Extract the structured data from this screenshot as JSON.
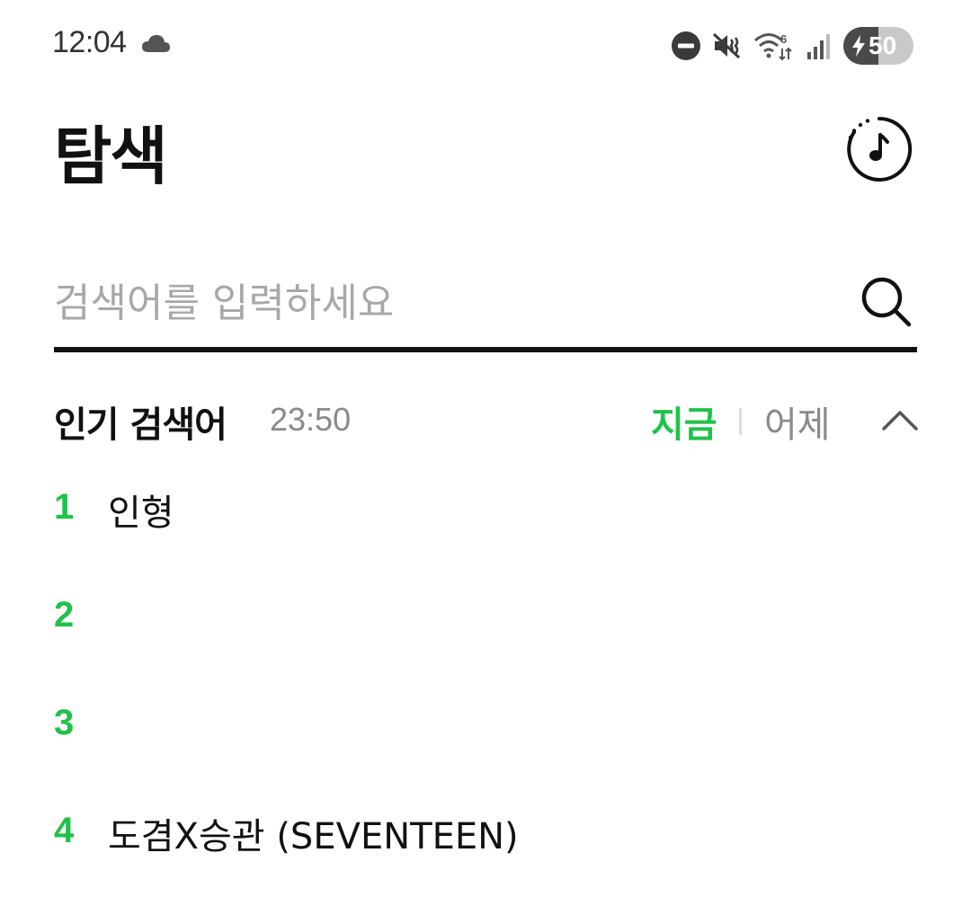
{
  "status_bar": {
    "time": "12:04",
    "battery_level": "50",
    "battery_fraction": 0.5,
    "icons": [
      "cloud-icon",
      "do-not-disturb-icon",
      "mute-icon",
      "wifi-6-icon",
      "signal-icon",
      "battery-charging-icon"
    ]
  },
  "header": {
    "title": "탐색",
    "music_icon": "music-recognition-icon"
  },
  "search": {
    "placeholder": "검색어를 입력하세요",
    "value": ""
  },
  "popular": {
    "title": "인기 검색어",
    "time": "23:50",
    "tabs": [
      {
        "label": "지금",
        "active": true
      },
      {
        "label": "어제",
        "active": false
      }
    ],
    "items": [
      {
        "rank": "1",
        "text": "인형"
      },
      {
        "rank": "2",
        "text": ""
      },
      {
        "rank": "3",
        "text": ""
      },
      {
        "rank": "4",
        "text": "도겸X승관 (SEVENTEEN)"
      }
    ]
  },
  "colors": {
    "accent_green": "#1fc24a",
    "text_primary": "#111111",
    "text_secondary": "#8a8a8a",
    "placeholder": "#a8a8a8"
  }
}
